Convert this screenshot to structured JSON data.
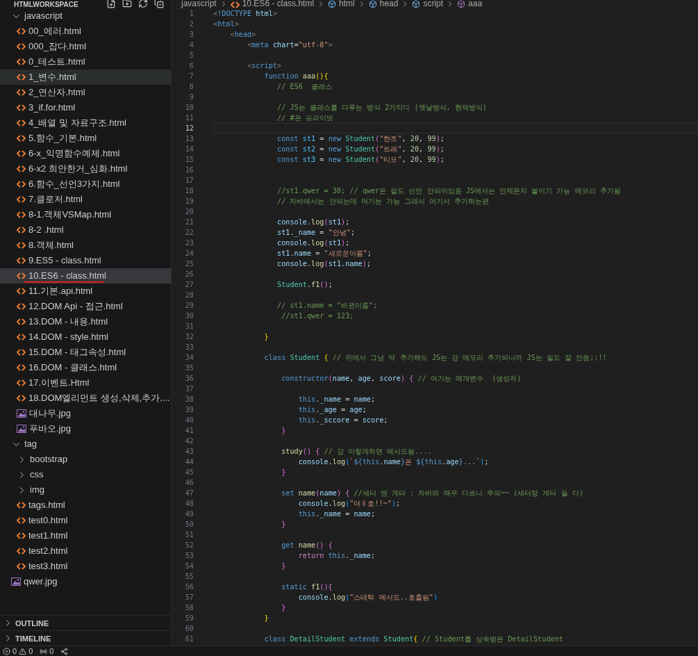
{
  "explorer": {
    "title": "HTMLWORKSPACE",
    "tree": [
      {
        "kind": "folder",
        "label": "javascript",
        "expanded": true,
        "selected": false,
        "hovered": false,
        "children": [
          {
            "kind": "html",
            "label": "00_에러.html",
            "selected": false,
            "hovered": false,
            "underlined": false
          },
          {
            "kind": "html",
            "label": "000_잡다.html",
            "selected": false,
            "hovered": false,
            "underlined": false
          },
          {
            "kind": "html",
            "label": "0_테스트.html",
            "selected": false,
            "hovered": false,
            "underlined": false
          },
          {
            "kind": "html",
            "label": "1_변수.html",
            "selected": false,
            "hovered": true,
            "underlined": false
          },
          {
            "kind": "html",
            "label": "2_연산자.html",
            "selected": false,
            "hovered": false,
            "underlined": false
          },
          {
            "kind": "html",
            "label": "3_if.for.html",
            "selected": false,
            "hovered": false,
            "underlined": false
          },
          {
            "kind": "html",
            "label": "4_배열 및 자료구조.html",
            "selected": false,
            "hovered": false,
            "underlined": false
          },
          {
            "kind": "html",
            "label": "5.함수_기본.html",
            "selected": false,
            "hovered": false,
            "underlined": false
          },
          {
            "kind": "html",
            "label": "6-x_익명함수예제.html",
            "selected": false,
            "hovered": false,
            "underlined": false
          },
          {
            "kind": "html",
            "label": "6-x2 희안한거_심화.html",
            "selected": false,
            "hovered": false,
            "underlined": false
          },
          {
            "kind": "html",
            "label": "6.함수_선언3가지.html",
            "selected": false,
            "hovered": false,
            "underlined": false
          },
          {
            "kind": "html",
            "label": "7.클로저.html",
            "selected": false,
            "hovered": false,
            "underlined": false
          },
          {
            "kind": "html",
            "label": "8-1.객체VSMap.html",
            "selected": false,
            "hovered": false,
            "underlined": false
          },
          {
            "kind": "html",
            "label": "8-2 .html",
            "selected": false,
            "hovered": false,
            "underlined": false
          },
          {
            "kind": "html",
            "label": "8.객체.html",
            "selected": false,
            "hovered": false,
            "underlined": false
          },
          {
            "kind": "html",
            "label": "9.ES5 - class.html",
            "selected": false,
            "hovered": false,
            "underlined": false
          },
          {
            "kind": "html",
            "label": "10.ES6 - class.html",
            "selected": true,
            "hovered": false,
            "underlined": true
          },
          {
            "kind": "html",
            "label": "11.기본.api.html",
            "selected": false,
            "hovered": false,
            "underlined": false
          },
          {
            "kind": "html",
            "label": "12.DOM Api - 접근.html",
            "selected": false,
            "hovered": false,
            "underlined": false
          },
          {
            "kind": "html",
            "label": "13.DOM - 내용.html",
            "selected": false,
            "hovered": false,
            "underlined": false
          },
          {
            "kind": "html",
            "label": "14.DOM - style.html",
            "selected": false,
            "hovered": false,
            "underlined": false
          },
          {
            "kind": "html",
            "label": "15.DOM - 태그속성.html",
            "selected": false,
            "hovered": false,
            "underlined": false
          },
          {
            "kind": "html",
            "label": "16.DOM - 클래스.html",
            "selected": false,
            "hovered": false,
            "underlined": false
          },
          {
            "kind": "html",
            "label": "17.이벤트.Html",
            "selected": false,
            "hovered": false,
            "underlined": false
          },
          {
            "kind": "html",
            "label": "18.DOM엘리먼트 생성,삭제,추가....",
            "selected": false,
            "hovered": false,
            "underlined": false
          },
          {
            "kind": "image",
            "label": "대나무.jpg",
            "selected": false,
            "hovered": false,
            "underlined": false
          },
          {
            "kind": "image",
            "label": "푸바오.jpg",
            "selected": false,
            "hovered": false,
            "underlined": false
          }
        ]
      },
      {
        "kind": "folder",
        "label": "tag",
        "expanded": true,
        "selected": false,
        "hovered": false,
        "children": [
          {
            "kind": "folder",
            "label": "bootstrap",
            "expanded": false,
            "selected": false,
            "hovered": false
          },
          {
            "kind": "folder",
            "label": "css",
            "expanded": false,
            "selected": false,
            "hovered": false
          },
          {
            "kind": "folder",
            "label": "img",
            "expanded": false,
            "selected": false,
            "hovered": false
          },
          {
            "kind": "html",
            "label": "tags.html",
            "selected": false,
            "hovered": false,
            "underlined": false
          },
          {
            "kind": "html",
            "label": "test0.html",
            "selected": false,
            "hovered": false,
            "underlined": false
          },
          {
            "kind": "html",
            "label": "test1.html",
            "selected": false,
            "hovered": false,
            "underlined": false
          },
          {
            "kind": "html",
            "label": "test2.html",
            "selected": false,
            "hovered": false,
            "underlined": false
          },
          {
            "kind": "html",
            "label": "test3.html",
            "selected": false,
            "hovered": false,
            "underlined": false
          }
        ]
      },
      {
        "kind": "image",
        "label": "qwer.jpg",
        "selected": false,
        "hovered": false,
        "underlined": false
      }
    ]
  },
  "panels": [
    {
      "title": "OUTLINE",
      "expanded": false
    },
    {
      "title": "TIMELINE",
      "expanded": false
    }
  ],
  "status_bar": {
    "errors": "0",
    "warnings": "0",
    "ports": "0"
  },
  "breadcrumb": [
    {
      "kind": "folder",
      "label": "javascript"
    },
    {
      "kind": "html",
      "label": "10.ES6 - class.html"
    },
    {
      "kind": "element",
      "label": "html"
    },
    {
      "kind": "element",
      "label": "head"
    },
    {
      "kind": "element",
      "label": "script"
    },
    {
      "kind": "function",
      "label": "aaa"
    }
  ],
  "editor": {
    "lines": [
      {
        "n": "1",
        "current": false,
        "tokens": [
          {
            "text": "<",
            "kind": "tag"
          },
          {
            "text": "!DOCTYPE",
            "kind": "keyword"
          },
          {
            "text": " html",
            "kind": "variable"
          },
          {
            "text": ">",
            "kind": "tag"
          }
        ]
      },
      {
        "n": "2",
        "current": false,
        "tokens": [
          {
            "text": "<",
            "kind": "tag"
          },
          {
            "text": "html",
            "kind": "keyword"
          },
          {
            "text": ">",
            "kind": "tag"
          }
        ]
      },
      {
        "n": "3",
        "current": false,
        "tokens": [
          {
            "text": "    <",
            "kind": "tag"
          },
          {
            "text": "head",
            "kind": "keyword"
          },
          {
            "text": ">",
            "kind": "tag"
          }
        ]
      },
      {
        "n": "4",
        "current": false,
        "tokens": [
          {
            "text": "        <",
            "kind": "tag"
          },
          {
            "text": "meta",
            "kind": "keyword"
          },
          {
            "text": " chart",
            "kind": "variable"
          },
          {
            "text": "=",
            "kind": "punct"
          },
          {
            "text": "\"utf-8\"",
            "kind": "string"
          },
          {
            "text": ">",
            "kind": "tag"
          }
        ]
      },
      {
        "n": "5",
        "current": false
      },
      {
        "n": "6",
        "current": false,
        "tokens": [
          {
            "text": "        <",
            "kind": "tag"
          },
          {
            "text": "script",
            "kind": "keyword"
          },
          {
            "text": ">",
            "kind": "tag"
          }
        ]
      },
      {
        "n": "7",
        "current": false,
        "tokens": [
          {
            "text": "            function",
            "kind": "keyword"
          },
          {
            "text": " aaa",
            "kind": "function"
          },
          {
            "text": "(){",
            "kind": "bracket1"
          }
        ]
      },
      {
        "n": "8",
        "current": false,
        "tokens": [
          {
            "text": "               // ES6  클래스",
            "kind": "comment"
          }
        ]
      },
      {
        "n": "9",
        "current": false
      },
      {
        "n": "10",
        "current": false,
        "tokens": [
          {
            "text": "               // JS는 클래스를 다루는 방식 2가지다 (옛날방식, 현재방식)",
            "kind": "comment"
          }
        ]
      },
      {
        "n": "11",
        "current": false,
        "tokens": [
          {
            "text": "               // #은 프라이빗",
            "kind": "comment"
          }
        ]
      },
      {
        "n": "12",
        "current": true
      },
      {
        "n": "13",
        "current": false,
        "tokens": [
          {
            "text": "               const",
            "kind": "keyword"
          },
          {
            "text": " st1",
            "kind": "constant"
          },
          {
            "text": " = ",
            "kind": "punct"
          },
          {
            "text": "new",
            "kind": "keyword"
          },
          {
            "text": " Student",
            "kind": "type"
          },
          {
            "text": "(",
            "kind": "bracket2"
          },
          {
            "text": "\"한조\"",
            "kind": "string"
          },
          {
            "text": ", ",
            "kind": "punct"
          },
          {
            "text": "20",
            "kind": "number"
          },
          {
            "text": ", ",
            "kind": "punct"
          },
          {
            "text": "99",
            "kind": "number"
          },
          {
            "text": ")",
            "kind": "bracket2"
          },
          {
            "text": ";",
            "kind": "punct"
          }
        ]
      },
      {
        "n": "14",
        "current": false,
        "tokens": [
          {
            "text": "               const",
            "kind": "keyword"
          },
          {
            "text": " st2",
            "kind": "constant"
          },
          {
            "text": " = ",
            "kind": "punct"
          },
          {
            "text": "new",
            "kind": "keyword"
          },
          {
            "text": " Student",
            "kind": "type"
          },
          {
            "text": "(",
            "kind": "bracket2"
          },
          {
            "text": "\"트레\"",
            "kind": "string"
          },
          {
            "text": ", ",
            "kind": "punct"
          },
          {
            "text": "20",
            "kind": "number"
          },
          {
            "text": ", ",
            "kind": "punct"
          },
          {
            "text": "99",
            "kind": "number"
          },
          {
            "text": ")",
            "kind": "bracket2"
          },
          {
            "text": ";",
            "kind": "punct"
          }
        ]
      },
      {
        "n": "15",
        "current": false,
        "tokens": [
          {
            "text": "               const",
            "kind": "keyword"
          },
          {
            "text": " st3",
            "kind": "constant"
          },
          {
            "text": " = ",
            "kind": "punct"
          },
          {
            "text": "new",
            "kind": "keyword"
          },
          {
            "text": " Student",
            "kind": "type"
          },
          {
            "text": "(",
            "kind": "bracket2"
          },
          {
            "text": "\"티모\"",
            "kind": "string"
          },
          {
            "text": ", ",
            "kind": "punct"
          },
          {
            "text": "20",
            "kind": "number"
          },
          {
            "text": ", ",
            "kind": "punct"
          },
          {
            "text": "99",
            "kind": "number"
          },
          {
            "text": ")",
            "kind": "bracket2"
          },
          {
            "text": ";",
            "kind": "punct"
          }
        ]
      },
      {
        "n": "16",
        "current": false
      },
      {
        "n": "17",
        "current": false
      },
      {
        "n": "18",
        "current": false,
        "tokens": [
          {
            "text": "               //st1.qwer = 30; // qwer은 필드 선언 안되어있음 JS에서는 언제든지 붙이기 가능 메모리 추가됨",
            "kind": "comment"
          }
        ]
      },
      {
        "n": "19",
        "current": false,
        "tokens": [
          {
            "text": "               // 자바에서는 안되는데 여기는 가능 그래서 여기서 추가하는편",
            "kind": "comment"
          }
        ]
      },
      {
        "n": "20",
        "current": false
      },
      {
        "n": "21",
        "current": false,
        "tokens": [
          {
            "text": "               console",
            "kind": "variable"
          },
          {
            "text": ".",
            "kind": "punct"
          },
          {
            "text": "log",
            "kind": "function"
          },
          {
            "text": "(",
            "kind": "bracket2"
          },
          {
            "text": "st1",
            "kind": "variable"
          },
          {
            "text": ")",
            "kind": "bracket2"
          },
          {
            "text": ";",
            "kind": "punct"
          }
        ]
      },
      {
        "n": "22",
        "current": false,
        "tokens": [
          {
            "text": "               st1",
            "kind": "variable"
          },
          {
            "text": ".",
            "kind": "punct"
          },
          {
            "text": "_name",
            "kind": "variable"
          },
          {
            "text": " = ",
            "kind": "punct"
          },
          {
            "text": "\"안녕\"",
            "kind": "string"
          },
          {
            "text": ";",
            "kind": "punct"
          }
        ]
      },
      {
        "n": "23",
        "current": false,
        "tokens": [
          {
            "text": "               console",
            "kind": "variable"
          },
          {
            "text": ".",
            "kind": "punct"
          },
          {
            "text": "log",
            "kind": "function"
          },
          {
            "text": "(",
            "kind": "bracket2"
          },
          {
            "text": "st1",
            "kind": "variable"
          },
          {
            "text": ")",
            "kind": "bracket2"
          },
          {
            "text": ";",
            "kind": "punct"
          }
        ]
      },
      {
        "n": "24",
        "current": false,
        "tokens": [
          {
            "text": "               st1",
            "kind": "variable"
          },
          {
            "text": ".",
            "kind": "punct"
          },
          {
            "text": "name",
            "kind": "variable"
          },
          {
            "text": " = ",
            "kind": "punct"
          },
          {
            "text": "\"새로운이름\"",
            "kind": "string"
          },
          {
            "text": ";",
            "kind": "punct"
          }
        ]
      },
      {
        "n": "25",
        "current": false,
        "tokens": [
          {
            "text": "               console",
            "kind": "variable"
          },
          {
            "text": ".",
            "kind": "punct"
          },
          {
            "text": "log",
            "kind": "function"
          },
          {
            "text": "(",
            "kind": "bracket2"
          },
          {
            "text": "st1",
            "kind": "variable"
          },
          {
            "text": ".",
            "kind": "punct"
          },
          {
            "text": "name",
            "kind": "variable"
          },
          {
            "text": ")",
            "kind": "bracket2"
          },
          {
            "text": ";",
            "kind": "punct"
          }
        ]
      },
      {
        "n": "26",
        "current": false
      },
      {
        "n": "27",
        "current": false,
        "tokens": [
          {
            "text": "               Student",
            "kind": "type"
          },
          {
            "text": ".",
            "kind": "punct"
          },
          {
            "text": "f1",
            "kind": "function"
          },
          {
            "text": "()",
            "kind": "bracket2"
          },
          {
            "text": ";",
            "kind": "punct"
          }
        ]
      },
      {
        "n": "28",
        "current": false
      },
      {
        "n": "29",
        "current": false,
        "tokens": [
          {
            "text": "               // st1.name = \"바뀐이름\";",
            "kind": "comment"
          }
        ]
      },
      {
        "n": "30",
        "current": false,
        "tokens": [
          {
            "text": "                //st1.qwer = 123;",
            "kind": "comment"
          }
        ]
      },
      {
        "n": "31",
        "current": false
      },
      {
        "n": "32",
        "current": false,
        "tokens": [
          {
            "text": "            }",
            "kind": "bracket1"
          }
        ]
      },
      {
        "n": "33",
        "current": false
      },
      {
        "n": "34",
        "current": false,
        "tokens": [
          {
            "text": "            class",
            "kind": "keyword"
          },
          {
            "text": " Student",
            "kind": "type"
          },
          {
            "text": " {",
            "kind": "bracket1"
          },
          {
            "text": " // 위에서 그냥 막 추가해도 JS는 걍 메모리 추가되니까 JS는 필드 잘 안씀;;!!",
            "kind": "comment"
          }
        ]
      },
      {
        "n": "35",
        "current": false
      },
      {
        "n": "36",
        "current": false,
        "tokens": [
          {
            "text": "                constructor",
            "kind": "keyword"
          },
          {
            "text": "(",
            "kind": "bracket2"
          },
          {
            "text": "name",
            "kind": "variable"
          },
          {
            "text": ", ",
            "kind": "punct"
          },
          {
            "text": "age",
            "kind": "variable"
          },
          {
            "text": ", ",
            "kind": "punct"
          },
          {
            "text": "score",
            "kind": "variable"
          },
          {
            "text": ")",
            "kind": "bracket2"
          },
          {
            "text": " {",
            "kind": "bracket2"
          },
          {
            "text": " // 여기는 매개변수  (생성자)",
            "kind": "comment"
          }
        ]
      },
      {
        "n": "37",
        "current": false
      },
      {
        "n": "38",
        "current": false,
        "tokens": [
          {
            "text": "                    this",
            "kind": "keyword"
          },
          {
            "text": ".",
            "kind": "punct"
          },
          {
            "text": "_name",
            "kind": "variable"
          },
          {
            "text": " = ",
            "kind": "punct"
          },
          {
            "text": "name",
            "kind": "variable"
          },
          {
            "text": ";",
            "kind": "punct"
          }
        ]
      },
      {
        "n": "39",
        "current": false,
        "tokens": [
          {
            "text": "                    this",
            "kind": "keyword"
          },
          {
            "text": ".",
            "kind": "punct"
          },
          {
            "text": "_age",
            "kind": "variable"
          },
          {
            "text": " = ",
            "kind": "punct"
          },
          {
            "text": "age",
            "kind": "variable"
          },
          {
            "text": ";",
            "kind": "punct"
          }
        ]
      },
      {
        "n": "40",
        "current": false,
        "tokens": [
          {
            "text": "                    this",
            "kind": "keyword"
          },
          {
            "text": ".",
            "kind": "punct"
          },
          {
            "text": "_sccore",
            "kind": "variable"
          },
          {
            "text": " = ",
            "kind": "punct"
          },
          {
            "text": "score",
            "kind": "variable"
          },
          {
            "text": ";",
            "kind": "punct"
          }
        ]
      },
      {
        "n": "41",
        "current": false,
        "tokens": [
          {
            "text": "                }",
            "kind": "bracket2"
          }
        ]
      },
      {
        "n": "42",
        "current": false
      },
      {
        "n": "43",
        "current": false,
        "tokens": [
          {
            "text": "                study",
            "kind": "function"
          },
          {
            "text": "()",
            "kind": "bracket2"
          },
          {
            "text": " {",
            "kind": "bracket2"
          },
          {
            "text": " // 걍 이렇게하면 메서드됨....",
            "kind": "comment"
          }
        ]
      },
      {
        "n": "44",
        "current": false,
        "tokens": [
          {
            "text": "                    console",
            "kind": "variable"
          },
          {
            "text": ".",
            "kind": "punct"
          },
          {
            "text": "log",
            "kind": "function"
          },
          {
            "text": "(",
            "kind": "bracket3"
          },
          {
            "text": "`",
            "kind": "string"
          },
          {
            "text": "${",
            "kind": "keyword"
          },
          {
            "text": "this",
            "kind": "keyword"
          },
          {
            "text": ".",
            "kind": "punct"
          },
          {
            "text": "name",
            "kind": "variable"
          },
          {
            "text": "}",
            "kind": "keyword"
          },
          {
            "text": "은 ",
            "kind": "string"
          },
          {
            "text": "${",
            "kind": "keyword"
          },
          {
            "text": "this",
            "kind": "keyword"
          },
          {
            "text": ".",
            "kind": "punct"
          },
          {
            "text": "age",
            "kind": "variable"
          },
          {
            "text": "}",
            "kind": "keyword"
          },
          {
            "text": "...`",
            "kind": "string"
          },
          {
            "text": ")",
            "kind": "bracket3"
          },
          {
            "text": ";",
            "kind": "punct"
          }
        ]
      },
      {
        "n": "45",
        "current": false,
        "tokens": [
          {
            "text": "                }",
            "kind": "bracket2"
          }
        ]
      },
      {
        "n": "46",
        "current": false
      },
      {
        "n": "47",
        "current": false,
        "tokens": [
          {
            "text": "                set",
            "kind": "keyword"
          },
          {
            "text": " name",
            "kind": "function"
          },
          {
            "text": "(",
            "kind": "bracket2"
          },
          {
            "text": "name",
            "kind": "variable"
          },
          {
            "text": ")",
            "kind": "bracket2"
          },
          {
            "text": " {",
            "kind": "bracket2"
          },
          {
            "text": " //세터 앤 게터 : 자바와 매우 다르니 주의~~ (세터랑 게터 둘 다)",
            "kind": "comment"
          }
        ]
      },
      {
        "n": "48",
        "current": false,
        "tokens": [
          {
            "text": "                    console",
            "kind": "variable"
          },
          {
            "text": ".",
            "kind": "punct"
          },
          {
            "text": "log",
            "kind": "function"
          },
          {
            "text": "(",
            "kind": "bracket3"
          },
          {
            "text": "\"야ㅐ호!!~\"",
            "kind": "string"
          },
          {
            "text": ")",
            "kind": "bracket3"
          },
          {
            "text": ";",
            "kind": "punct"
          }
        ]
      },
      {
        "n": "49",
        "current": false,
        "tokens": [
          {
            "text": "                    this",
            "kind": "keyword"
          },
          {
            "text": ".",
            "kind": "punct"
          },
          {
            "text": "_name",
            "kind": "variable"
          },
          {
            "text": " = ",
            "kind": "punct"
          },
          {
            "text": "name",
            "kind": "variable"
          },
          {
            "text": ";",
            "kind": "punct"
          }
        ]
      },
      {
        "n": "50",
        "current": false,
        "tokens": [
          {
            "text": "                }",
            "kind": "bracket2"
          }
        ]
      },
      {
        "n": "51",
        "current": false
      },
      {
        "n": "52",
        "current": false,
        "tokens": [
          {
            "text": "                get",
            "kind": "keyword"
          },
          {
            "text": " name",
            "kind": "function"
          },
          {
            "text": "()",
            "kind": "bracket2"
          },
          {
            "text": " {",
            "kind": "bracket2"
          }
        ]
      },
      {
        "n": "53",
        "current": false,
        "tokens": [
          {
            "text": "                    return",
            "kind": "control"
          },
          {
            "text": " this",
            "kind": "keyword"
          },
          {
            "text": ".",
            "kind": "punct"
          },
          {
            "text": "_name",
            "kind": "variable"
          },
          {
            "text": ";",
            "kind": "punct"
          }
        ]
      },
      {
        "n": "54",
        "current": false,
        "tokens": [
          {
            "text": "                }",
            "kind": "bracket2"
          }
        ]
      },
      {
        "n": "55",
        "current": false
      },
      {
        "n": "56",
        "current": false,
        "tokens": [
          {
            "text": "                static",
            "kind": "keyword"
          },
          {
            "text": " f1",
            "kind": "function"
          },
          {
            "text": "(){",
            "kind": "bracket2"
          }
        ]
      },
      {
        "n": "57",
        "current": false,
        "tokens": [
          {
            "text": "                    console",
            "kind": "variable"
          },
          {
            "text": ".",
            "kind": "punct"
          },
          {
            "text": "log",
            "kind": "function"
          },
          {
            "text": "(",
            "kind": "bracket3"
          },
          {
            "text": "\"스태틱 메서드..호출됨\"",
            "kind": "string"
          },
          {
            "text": ")",
            "kind": "bracket3"
          }
        ]
      },
      {
        "n": "58",
        "current": false,
        "tokens": [
          {
            "text": "                }",
            "kind": "bracket2"
          }
        ]
      },
      {
        "n": "59",
        "current": false,
        "tokens": [
          {
            "text": "            }",
            "kind": "bracket1"
          }
        ]
      },
      {
        "n": "60",
        "current": false
      },
      {
        "n": "61",
        "current": false,
        "tokens": [
          {
            "text": "            class",
            "kind": "keyword"
          },
          {
            "text": " DetailStudent",
            "kind": "type"
          },
          {
            "text": " extends",
            "kind": "keyword"
          },
          {
            "text": " Student",
            "kind": "type"
          },
          {
            "text": "{",
            "kind": "bracket1"
          },
          {
            "text": " // Student를 상속받은 DetailStudent",
            "kind": "comment"
          }
        ]
      }
    ]
  }
}
